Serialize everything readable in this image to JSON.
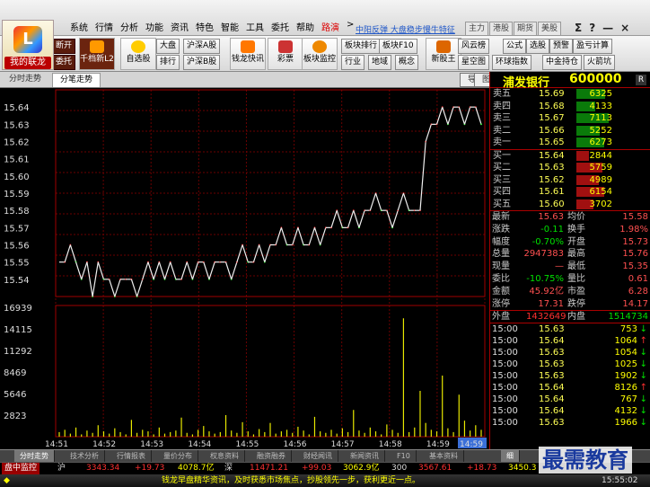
{
  "app": {
    "brand": "我的联龙"
  },
  "menu": [
    "系统",
    "行情",
    "分析",
    "功能",
    "资讯",
    "特色",
    "智能",
    "工具",
    "委托",
    "帮助",
    "路演",
    ">"
  ],
  "ticker_text": "中阳反弹 大盘稳步慢牛特征",
  "market_tabs": [
    "主力",
    "港股",
    "期货",
    "美股"
  ],
  "window_controls": [
    "Σ",
    "?",
    "—",
    "×"
  ],
  "toolbar": {
    "buttons_row1": [
      "断开",
      "大盘",
      "沪深A股",
      "板块排行",
      "板块F10",
      "风云榜",
      "公式",
      "选股",
      "预警",
      "盈亏计算"
    ],
    "buttons_row2": [
      "委托",
      "排行",
      "沪深B股",
      "行业",
      "地域",
      "概念",
      "星空图",
      "环球指数",
      "中金持仓",
      "火箭坑"
    ],
    "big": [
      "千档新L2",
      "自选股",
      "钱龙快讯",
      "彩票",
      "板块监控",
      "新股王"
    ]
  },
  "chart_tabs": [
    "分时走势",
    "分笔走势"
  ],
  "chart_icons": [
    "导",
    "图"
  ],
  "chart_data": {
    "type": "line",
    "title": "",
    "price_ticks": [
      "15.64",
      "15.63",
      "15.62",
      "15.61",
      "15.60",
      "15.59",
      "15.58",
      "15.57",
      "15.56",
      "15.55",
      "15.54"
    ],
    "volume_ticks": [
      "16939",
      "14115",
      "11292",
      "8469",
      "5646",
      "2823"
    ],
    "x_ticks": [
      "14:51",
      "14:52",
      "14:53",
      "14:54",
      "14:55",
      "14:56",
      "14:57",
      "14:58",
      "14:59",
      "14:59"
    ],
    "ylim": [
      15.53,
      15.65
    ],
    "prices": [
      15.55,
      15.55,
      15.56,
      15.55,
      15.54,
      15.55,
      15.53,
      15.55,
      15.54,
      15.54,
      15.53,
      15.54,
      15.54,
      15.54,
      15.53,
      15.54,
      15.55,
      15.54,
      15.55,
      15.54,
      15.55,
      15.54,
      15.54,
      15.55,
      15.54,
      15.55,
      15.55,
      15.54,
      15.55,
      15.55,
      15.55,
      15.54,
      15.55,
      15.56,
      15.55,
      15.55,
      15.56,
      15.55,
      15.56,
      15.56,
      15.57,
      15.56,
      15.56,
      15.57,
      15.56,
      15.56,
      15.57,
      15.56,
      15.57,
      15.57,
      15.58,
      15.57,
      15.57,
      15.58,
      15.57,
      15.58,
      15.58,
      15.59,
      15.58,
      15.58,
      15.57,
      15.58,
      15.59,
      15.58,
      15.58,
      15.58,
      15.62,
      15.63,
      15.63,
      15.64,
      15.63,
      15.64,
      15.64,
      15.63,
      15.64,
      15.64,
      15.63
    ],
    "volumes": [
      600,
      900,
      400,
      1200,
      300,
      800,
      500,
      1500,
      700,
      400,
      1100,
      600,
      300,
      2200,
      500,
      900,
      700,
      300,
      1200,
      400,
      600,
      800,
      2500,
      500,
      300,
      900,
      1400,
      700,
      400,
      600,
      2823,
      800,
      500,
      1900,
      700,
      300,
      1000,
      600,
      1800,
      400,
      700,
      900,
      500,
      1300,
      800,
      300,
      2600,
      700,
      500,
      900,
      400,
      1100,
      600,
      3500,
      800,
      500,
      1200,
      700,
      300,
      1600,
      900,
      500,
      15500,
      600,
      1200,
      6000,
      1800,
      900,
      700,
      8000,
      1100,
      600,
      5500,
      2100,
      800,
      1500,
      900
    ]
  },
  "quote": {
    "name": "浦发银行",
    "code": "600000",
    "r": "R",
    "asks": [
      {
        "label": "卖五",
        "price": "15.69",
        "vol": "6325"
      },
      {
        "label": "卖四",
        "price": "15.68",
        "vol": "4133"
      },
      {
        "label": "卖三",
        "price": "15.67",
        "vol": "7113"
      },
      {
        "label": "卖二",
        "price": "15.66",
        "vol": "5252"
      },
      {
        "label": "卖一",
        "price": "15.65",
        "vol": "6273"
      }
    ],
    "bids": [
      {
        "label": "买一",
        "price": "15.64",
        "vol": "2844"
      },
      {
        "label": "买二",
        "price": "15.63",
        "vol": "5759"
      },
      {
        "label": "买三",
        "price": "15.62",
        "vol": "4989"
      },
      {
        "label": "买四",
        "price": "15.61",
        "vol": "6154"
      },
      {
        "label": "买五",
        "price": "15.60",
        "vol": "3702"
      }
    ],
    "stats": [
      {
        "l1": "最新",
        "v1": "15.63",
        "l2": "均价",
        "v2": "15.58"
      },
      {
        "l1": "涨跌",
        "v1": "-0.11",
        "l2": "换手",
        "v2": "1.98%"
      },
      {
        "l1": "幅度",
        "v1": "-0.70%",
        "l2": "开盘",
        "v2": "15.73"
      },
      {
        "l1": "总量",
        "v1": "2947383",
        "l2": "最高",
        "v2": "15.76"
      },
      {
        "l1": "现量",
        "v1": "—",
        "l2": "最低",
        "v2": "15.35"
      },
      {
        "l1": "委比",
        "v1": "-10.75%",
        "l2": "量比",
        "v2": "0.61"
      },
      {
        "l1": "金额",
        "v1": "45.92亿",
        "l2": "市盈",
        "v2": "6.28"
      },
      {
        "l1": "涨停",
        "v1": "17.31",
        "l2": "跌停",
        "v2": "14.17"
      }
    ],
    "outer_label": "外盘",
    "outer": "1432649",
    "inner_label": "内盘",
    "inner": "1514734",
    "ticks": [
      {
        "t": "15:00",
        "p": "15.63",
        "v": "753",
        "d": "↓"
      },
      {
        "t": "15:00",
        "p": "15.64",
        "v": "1064",
        "d": "↑"
      },
      {
        "t": "15:00",
        "p": "15.63",
        "v": "1054",
        "d": "↓"
      },
      {
        "t": "15:00",
        "p": "15.63",
        "v": "1025",
        "d": "↓"
      },
      {
        "t": "15:00",
        "p": "15.63",
        "v": "1902",
        "d": "↓"
      },
      {
        "t": "15:00",
        "p": "15.64",
        "v": "8126",
        "d": "↑"
      },
      {
        "t": "15:00",
        "p": "15.64",
        "v": "767",
        "d": "↓"
      },
      {
        "t": "15:00",
        "p": "15.64",
        "v": "4132",
        "d": "↓"
      },
      {
        "t": "15:00",
        "p": "15.63",
        "v": "1966",
        "d": "↓"
      }
    ]
  },
  "bottom_tabs": [
    "分时走势",
    "技术分析",
    "行情报表",
    "量价分布",
    "权息资料",
    "融资融券",
    "财经闻讯",
    "新闻资讯",
    "F10",
    "基本资料"
  ],
  "right_tab": "细",
  "index": {
    "sh": "沪",
    "sh_v": "3343.34",
    "sh_c": "+19.73",
    "sh_a": "4078.7亿",
    "sz": "深",
    "sz_v": "11471.21",
    "sz_c": "+99.03",
    "sz_a": "3062.9亿",
    "cy": "300",
    "cy_v": "3567.61",
    "cy_c": "+18.73",
    "cy_a": "3450.3"
  },
  "index_label": "盘中监控",
  "status_text": "钱龙早盘精华资讯，及时获悉市场焦点，抄股领先一步，获利更近一点。",
  "status_time": "15:55:02",
  "watermark": "最需教育",
  "colors": {
    "up": "#ff3030",
    "down": "#00e000",
    "price_yellow": "#ffff50",
    "grid": "#700000"
  }
}
